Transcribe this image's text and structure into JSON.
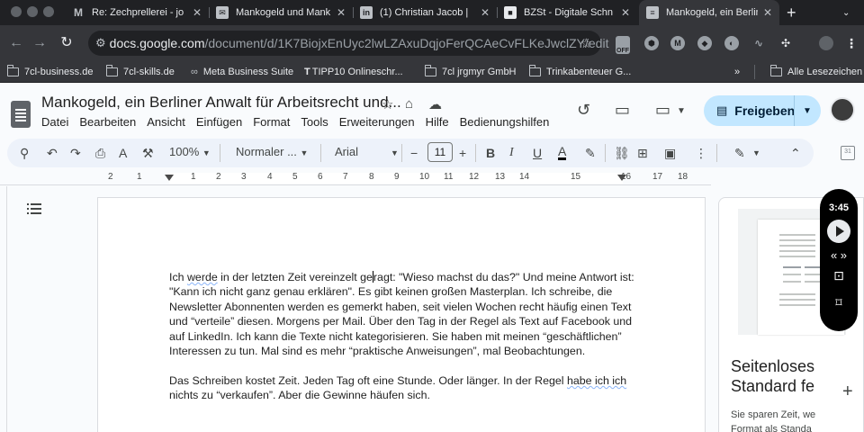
{
  "browser": {
    "tabs": [
      {
        "title": "Re: Zechprellerei - jo",
        "icon": "gmail-icon",
        "color": "#ea4335"
      },
      {
        "title": "Mankogeld und Mank",
        "icon": "mail-icon",
        "color": "#bdc1c6"
      },
      {
        "title": "(1) Christian Jacob |",
        "icon": "linkedin-icon",
        "color": "#0a66c2"
      },
      {
        "title": "BZSt - Digitale Schn",
        "icon": "bzst-icon",
        "color": "#e8eaed"
      },
      {
        "title": "Mankogeld, ein Berlin",
        "icon": "docs-icon",
        "color": "#4285f4",
        "active": true
      }
    ],
    "url_host": "docs.google.com",
    "url_path": "/document/d/1K7BiojxEnUyc2lwLZAxuDqjoFerQCAeCvFLKeJwclZY/edit",
    "extension_badge": "OFF",
    "bookmarks": [
      "7cl-business.de",
      "7cl-skills.de",
      "Meta Business Suite",
      "TIPP10 Onlineschr...",
      "7cl jrgmyr GmbH",
      "Trinkabenteuer G...",
      "Alle Lesezeichen"
    ],
    "bookmarks_overflow": "»"
  },
  "docs": {
    "title": "Mankogeld,  ein Berliner Anwalt für Arbeitsrecht und...",
    "menu": [
      "Datei",
      "Bearbeiten",
      "Ansicht",
      "Einfügen",
      "Format",
      "Tools",
      "Erweiterungen",
      "Hilfe",
      "Bedienungshilfen"
    ],
    "share_label": "Freigeben",
    "toolbar": {
      "zoom": "100%",
      "style": "Normaler ...",
      "font": "Arial",
      "font_size": "11"
    },
    "ruler_numbers": [
      "2",
      "1",
      "1",
      "2",
      "3",
      "4",
      "5",
      "6",
      "7",
      "8",
      "9",
      "10",
      "11",
      "12",
      "13",
      "14",
      "15",
      "16",
      "17",
      "18"
    ],
    "body": {
      "p1_before_cursor": "Ich ",
      "p1_word_werde": "werde",
      "p1_mid": " in der letzten Zeit vereinzelt ge",
      "p1_after_cursor": "ragt: \"Wieso machst du das?\" Und meine Antwort ist: \"Kann ich nicht ganz genau erklären\". Es gibt keinen großen Masterplan. Ich schreibe, die Newsletter Abonnenten werden es gemerkt haben, seit vielen Wochen recht häufig einen Text und “verteile” diesen. Morgens per Mail. Über den Tag in der Regel als Text auf Facebook und auf LinkedIn. Ich kann die Texte nicht kategorisieren. Sie haben mit meinen “geschäftlichen” Interessen zu tun. Mal sind es mehr “praktische Anweisungen”, mal Beobachtungen.",
      "p2_before": "Das Schreiben kostet Zeit. Jeden Tag oft eine Stunde. Oder länger. In der Regel ",
      "p2_squiggle": "habe ich ich",
      "p2_after": " nichts  zu “verkaufen”. Aber die Gewinne häufen sich."
    }
  },
  "side_panel": {
    "title_line1": "Seitenloses",
    "title_line2": "Standard fe",
    "body_line1": "Sie sparen Zeit, we",
    "body_line2": "Format als Standa"
  },
  "recorder": {
    "time": "3:45"
  }
}
